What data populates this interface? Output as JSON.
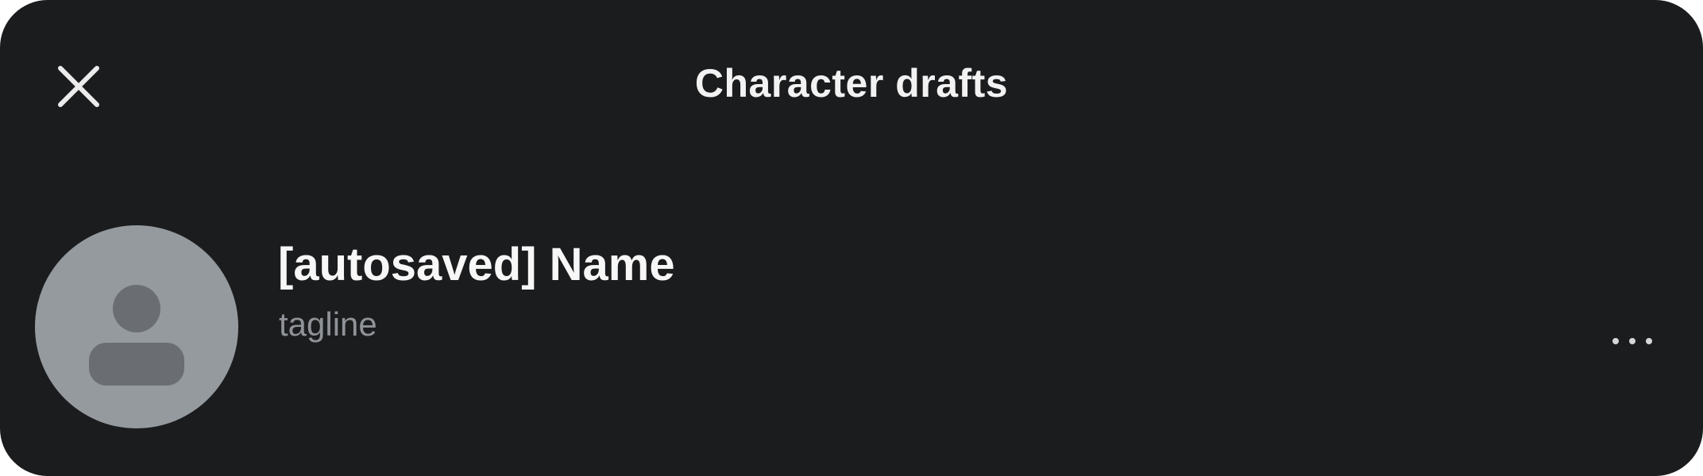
{
  "header": {
    "title": "Character drafts",
    "close_icon": "close-icon"
  },
  "drafts": [
    {
      "name": "[autosaved] Name",
      "tagline": "tagline",
      "avatar_icon": "person-placeholder-icon",
      "menu_icon": "more-horizontal-icon"
    }
  ],
  "colors": {
    "background": "#1b1c1e",
    "avatar_bg": "#959a9e",
    "avatar_glyph": "#6a6e73",
    "tagline": "#8f9397"
  }
}
